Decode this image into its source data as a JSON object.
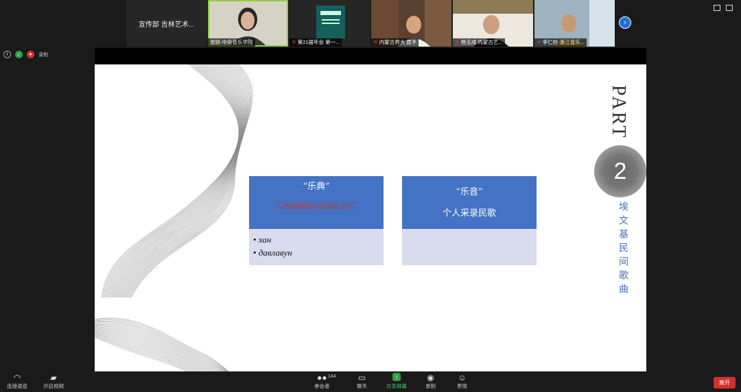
{
  "gallery": {
    "tiles": [
      {
        "name": "宣传部 吉林艺术..."
      },
      {
        "name": "张妍-中央音乐学院"
      },
      {
        "name": "第21届年会 第一..."
      },
      {
        "name": "内蒙古师大 聂丰"
      },
      {
        "name": "杨玉成 内蒙古艺..."
      },
      {
        "name": "李仁柱-浙江音乐..."
      }
    ]
  },
  "status": {
    "record_label": "录制"
  },
  "slide": {
    "part": "PART",
    "part_number": "2",
    "vertical_title": "埃文基民间歌曲",
    "box1": {
      "title": "“乐典”",
      "red_text": "“Эвенкийн ардын дуу”",
      "bullets": [
        "хан",
        "давлавун"
      ]
    },
    "box2": {
      "title": "“乐音”",
      "subtitle": "个人采录民歌"
    }
  },
  "toolbar": {
    "audio": "连接语音",
    "video": "开启视频",
    "participants": "参会者",
    "participant_count": "144",
    "chat": "聊天",
    "share": "共享屏幕",
    "record": "录制",
    "reactions": "表情",
    "leave": "离开"
  },
  "colors": {
    "accent_blue": "#4472c4",
    "box_body": "#d9dbef",
    "leave_red": "#d32f2f",
    "share_green": "#2ea043"
  }
}
